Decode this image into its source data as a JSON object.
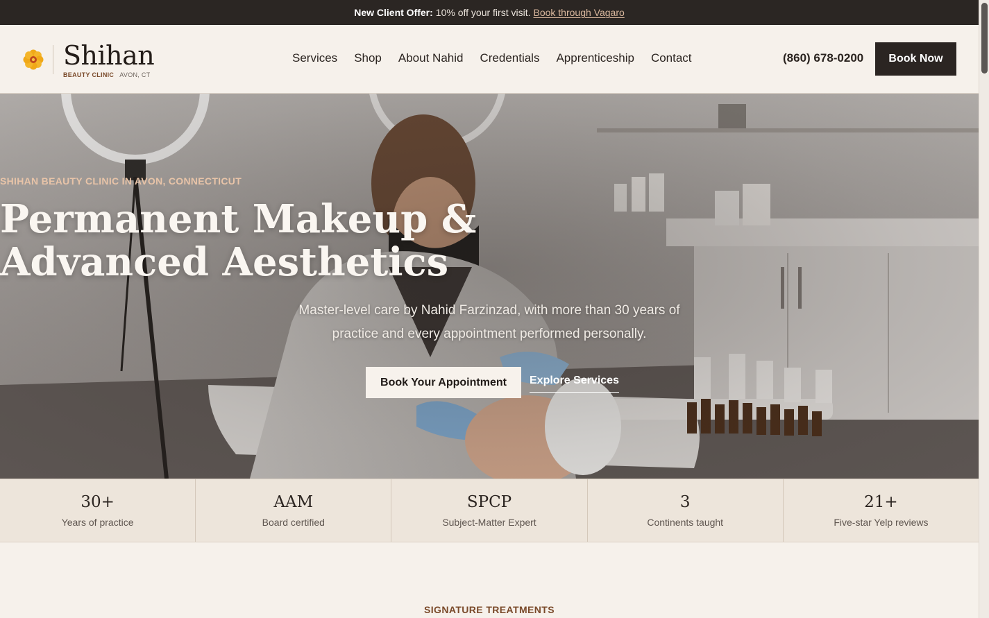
{
  "topbar": {
    "offer_label": "New Client Offer:",
    "offer_text": "10% off your first visit.",
    "offer_link": "Book through Vagaro"
  },
  "brand": {
    "name": "Shihan",
    "subtitle": "BEAUTY CLINIC",
    "location": "AVON, CT",
    "icon": "flower-icon",
    "icon_color": "#e8a020"
  },
  "nav": {
    "items": [
      "Services",
      "Shop",
      "About Nahid",
      "Credentials",
      "Apprenticeship",
      "Contact"
    ]
  },
  "header": {
    "phone": "(860) 678-0200",
    "book_label": "Book Now"
  },
  "hero": {
    "eyebrow": "SHIHAN BEAUTY CLINIC IN AVON, CONNECTICUT",
    "title_line1": "Permanent Makeup &",
    "title_line2": "Advanced Aesthetics",
    "subtitle": "Master-level care by Nahid Farzinzad, with more than 30 years of practice and every appointment performed personally.",
    "primary_cta": "Book Your Appointment",
    "secondary_cta": "Explore Services"
  },
  "stats": [
    {
      "value": "30+",
      "label": "Years of practice"
    },
    {
      "value": "AAM",
      "label": "Board certified"
    },
    {
      "value": "SPCP",
      "label": "Subject-Matter Expert"
    },
    {
      "value": "3",
      "label": "Continents taught"
    },
    {
      "value": "21+",
      "label": "Five-star Yelp reviews"
    }
  ],
  "next_section": {
    "eyebrow": "SIGNATURE TREATMENTS"
  },
  "colors": {
    "accent": "#7a4a2a",
    "dark": "#2b2522",
    "cream": "#f6f1eb"
  }
}
